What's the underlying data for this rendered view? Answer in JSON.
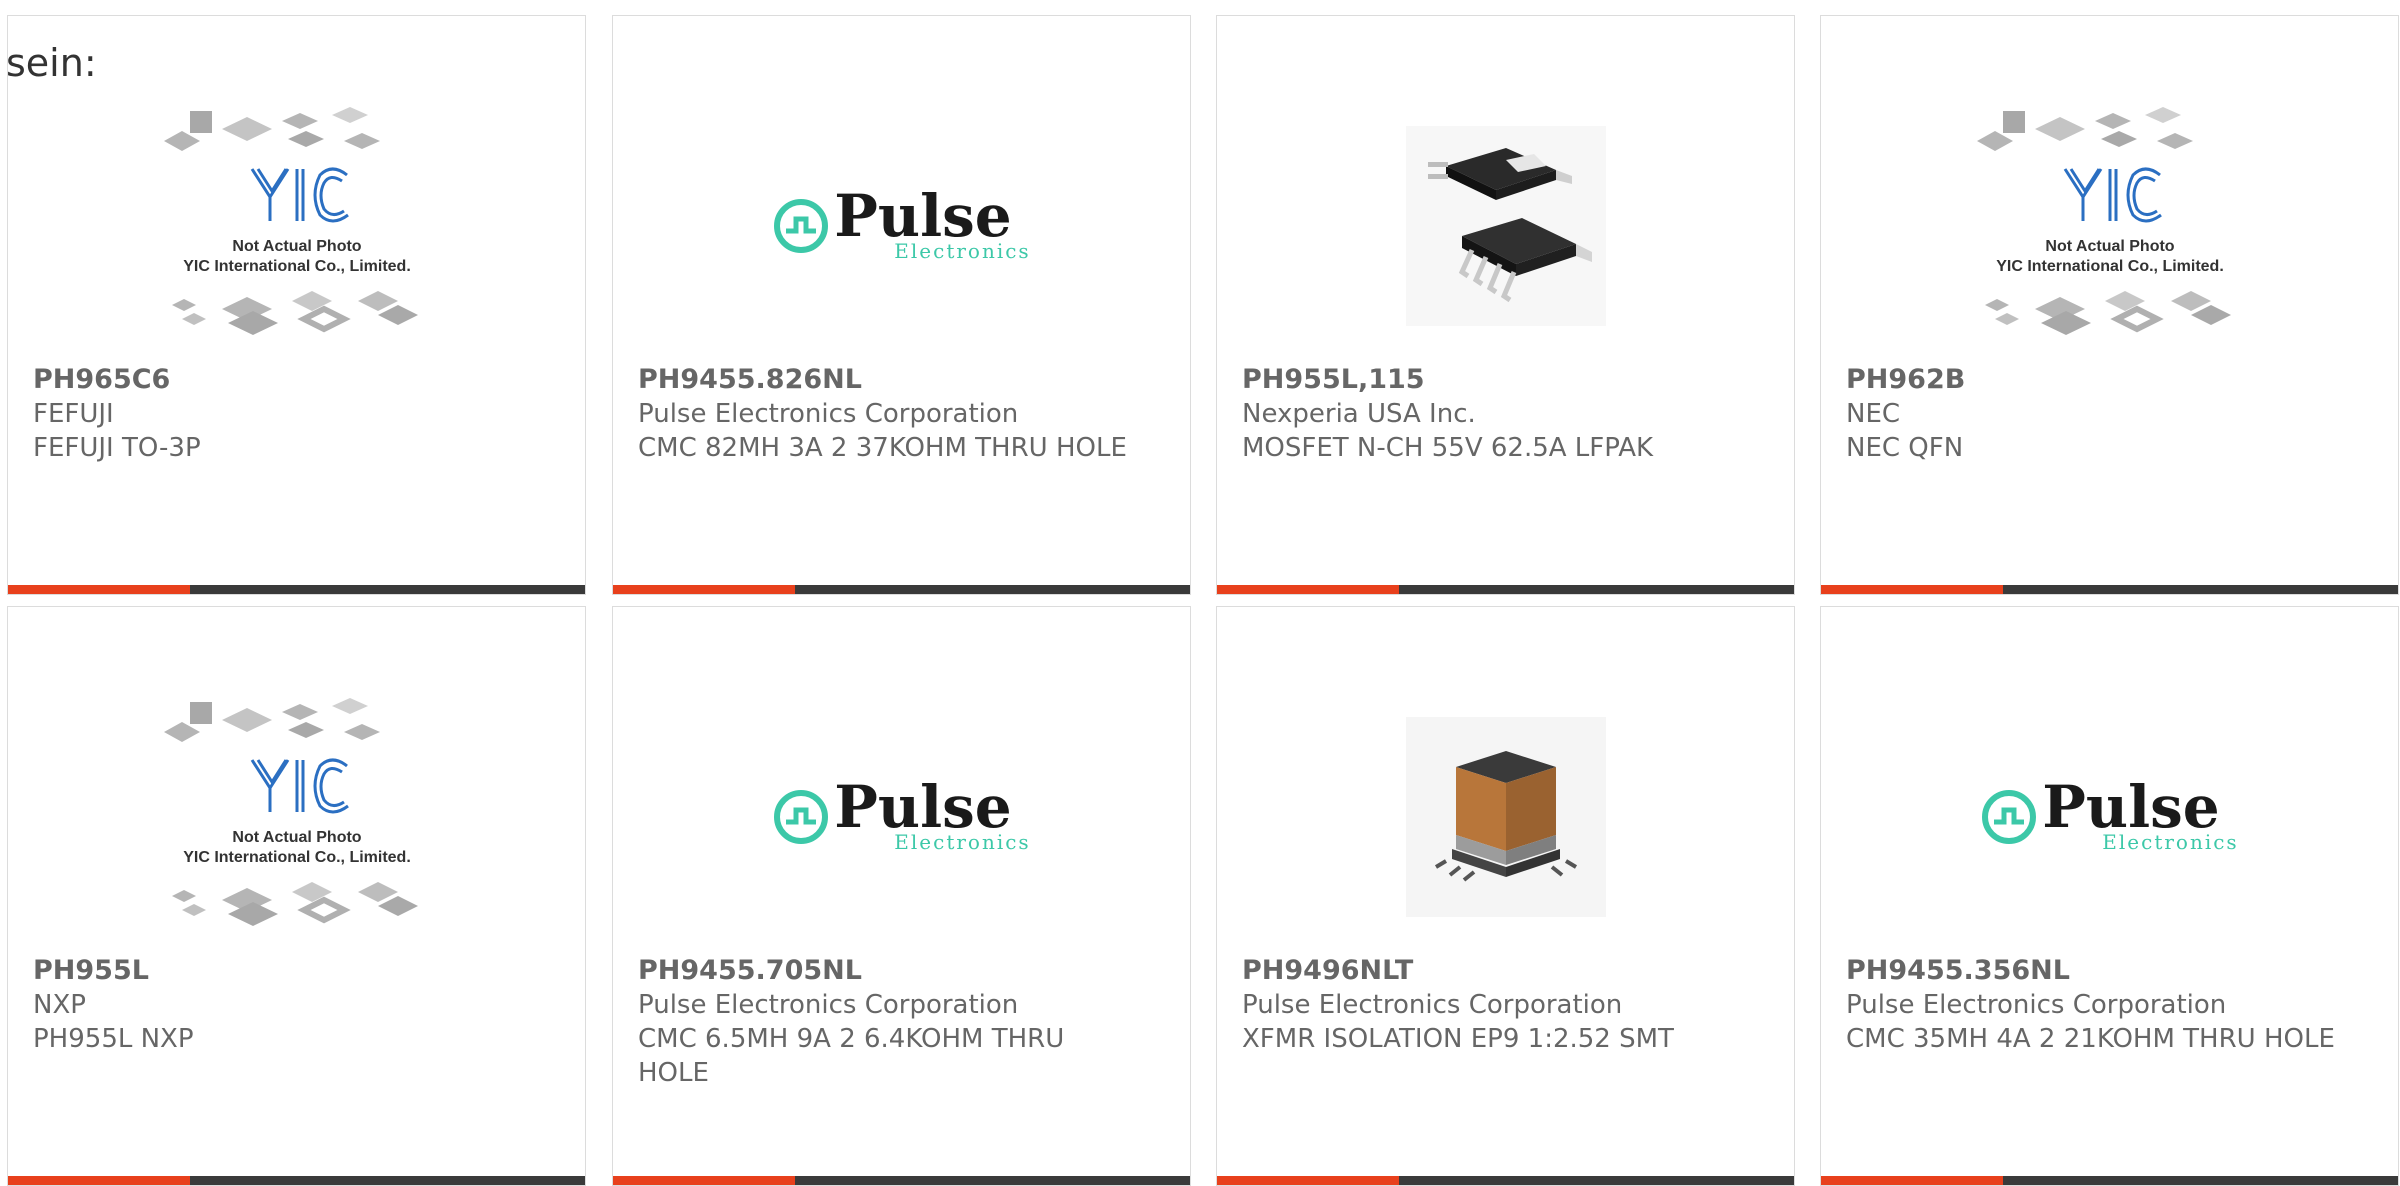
{
  "intro_text": "sein:",
  "brand": {
    "accent": "#e8401c",
    "bar": "#3a3a3a",
    "pulse_green": "#3cc8a8",
    "yic_blue": "#2b6fc2"
  },
  "logos": {
    "yic": {
      "mark": "YIC",
      "line1": "Not Actual Photo",
      "line2": "YIC International Co., Limited."
    },
    "pulse": {
      "name": "Pulse",
      "sub": "Electronics"
    }
  },
  "products": [
    {
      "part": "PH965C6",
      "manufacturer": "FEFUJI",
      "description": "FEFUJI TO-3P",
      "image": "yic-placeholder"
    },
    {
      "part": "PH9455.826NL",
      "manufacturer": "Pulse Electronics Corporation",
      "description": "CMC 82MH 3A 2 37KOHM THRU HOLE",
      "image": "pulse-logo"
    },
    {
      "part": "PH955L,115",
      "manufacturer": "Nexperia USA Inc.",
      "description": "MOSFET N-CH 55V 62.5A LFPAK",
      "image": "lfpak-package"
    },
    {
      "part": "PH962B",
      "manufacturer": "NEC",
      "description": "NEC QFN",
      "image": "yic-placeholder"
    },
    {
      "part": "PH955L",
      "manufacturer": "NXP",
      "description": "PH955L NXP",
      "image": "yic-placeholder"
    },
    {
      "part": "PH9455.705NL",
      "manufacturer": "Pulse Electronics Corporation",
      "description": "CMC 6.5MH 9A 2 6.4KOHM THRU HOLE",
      "image": "pulse-logo"
    },
    {
      "part": "PH9496NLT",
      "manufacturer": "Pulse Electronics Corporation",
      "description": "XFMR ISOLATION EP9 1:2.52 SMT",
      "image": "transformer-component"
    },
    {
      "part": "PH9455.356NL",
      "manufacturer": "Pulse Electronics Corporation",
      "description": "CMC 35MH 4A 2 21KOHM THRU HOLE",
      "image": "pulse-logo"
    }
  ]
}
